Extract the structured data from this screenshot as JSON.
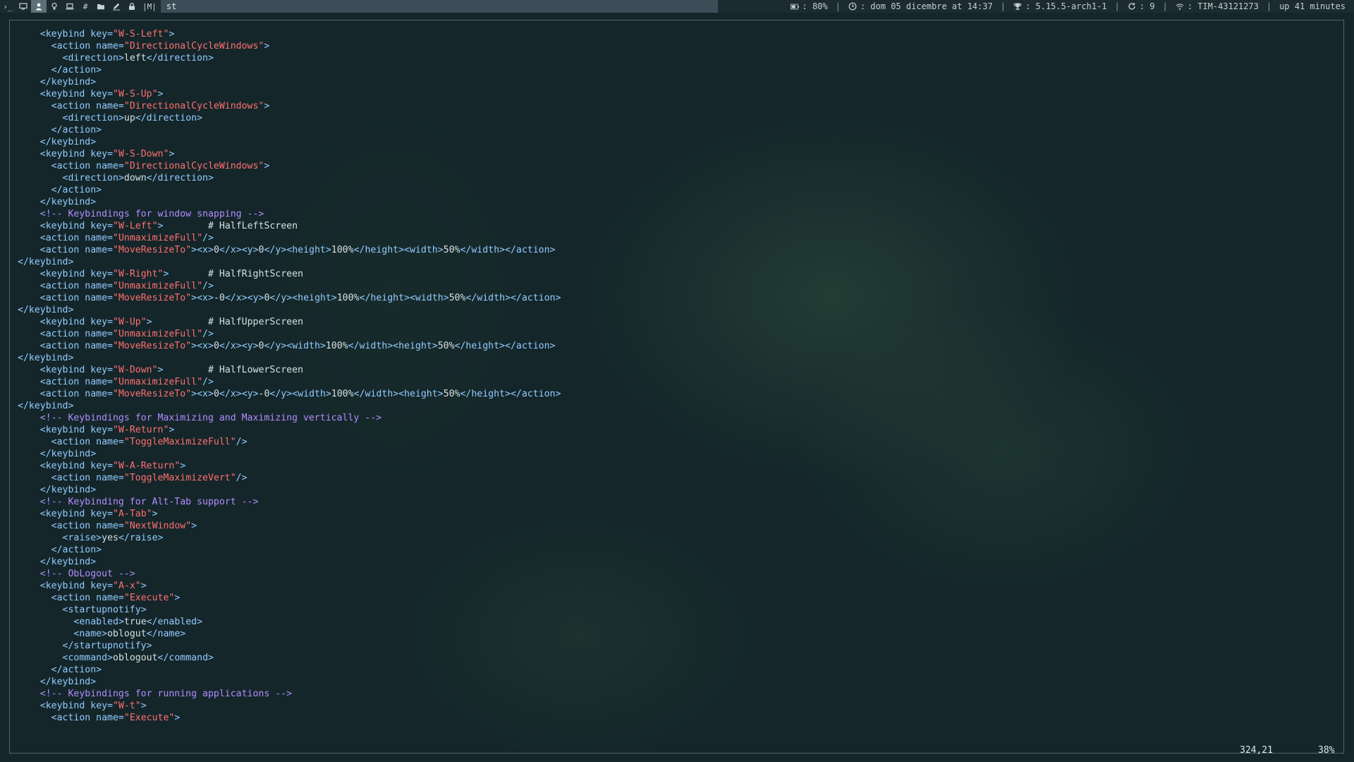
{
  "workspaces": [
    {
      "icon": "terminal-icon",
      "glyph": "›_"
    },
    {
      "icon": "monitor-icon",
      "glyph": ""
    },
    {
      "icon": "user-icon",
      "glyph": "",
      "active": true
    },
    {
      "icon": "lightbulb-icon",
      "glyph": ""
    },
    {
      "icon": "laptop-icon",
      "glyph": ""
    },
    {
      "icon": "hash-icon",
      "glyph": "#"
    },
    {
      "icon": "folder-icon",
      "glyph": ""
    },
    {
      "icon": "pencil-icon",
      "glyph": ""
    },
    {
      "icon": "lock-icon",
      "glyph": ""
    }
  ],
  "layout_symbol": "|M|",
  "window_title": "st",
  "status": {
    "battery": ": 80%",
    "clock": ": dom 05 dicembre at 14:37",
    "kernel": ": 5.15.5-arch1-1",
    "updates": ": 9",
    "wifi": ": TIM-43121273",
    "uptime": "up 41 minutes"
  },
  "colors": {
    "tag": "#93ccff",
    "string": "#ff6f6f",
    "comment": "#b48cff",
    "text": "#d7e0e1"
  },
  "editor": {
    "cursor_position": "324,21",
    "scroll_percent": "38%",
    "lines": [
      "    <keybind key=\"W-S-Left\">",
      "      <action name=\"DirectionalCycleWindows\">",
      "        <direction>left</direction>",
      "      </action>",
      "    </keybind>",
      "    <keybind key=\"W-S-Up\">",
      "      <action name=\"DirectionalCycleWindows\">",
      "        <direction>up</direction>",
      "      </action>",
      "    </keybind>",
      "    <keybind key=\"W-S-Down\">",
      "      <action name=\"DirectionalCycleWindows\">",
      "        <direction>down</direction>",
      "      </action>",
      "    </keybind>",
      "    <!-- Keybindings for window snapping -->",
      "    <keybind key=\"W-Left\">        # HalfLeftScreen",
      "    <action name=\"UnmaximizeFull\"/>",
      "    <action name=\"MoveResizeTo\"><x>0</x><y>0</y><height>100%</height><width>50%</width></action>",
      "</keybind>",
      "    <keybind key=\"W-Right\">       # HalfRightScreen",
      "    <action name=\"UnmaximizeFull\"/>",
      "    <action name=\"MoveResizeTo\"><x>-0</x><y>0</y><height>100%</height><width>50%</width></action>",
      "</keybind>",
      "    <keybind key=\"W-Up\">          # HalfUpperScreen",
      "    <action name=\"UnmaximizeFull\"/>",
      "    <action name=\"MoveResizeTo\"><x>0</x><y>0</y><width>100%</width><height>50%</height></action>",
      "</keybind>",
      "    <keybind key=\"W-Down\">        # HalfLowerScreen",
      "    <action name=\"UnmaximizeFull\"/>",
      "    <action name=\"MoveResizeTo\"><x>0</x><y>-0</y><width>100%</width><height>50%</height></action>",
      "</keybind>",
      "    <!-- Keybindings for Maximizing and Maximizing vertically -->",
      "    <keybind key=\"W-Return\">",
      "      <action name=\"ToggleMaximizeFull\"/>",
      "    </keybind>",
      "    <keybind key=\"W-A-Return\">",
      "      <action name=\"ToggleMaximizeVert\"/>",
      "    </keybind>",
      "    <!-- Keybinding for Alt-Tab support -->",
      "    <keybind key=\"A-Tab\">",
      "      <action name=\"NextWindow\">",
      "        <raise>yes</raise>",
      "      </action>",
      "    </keybind>",
      "    <!-- ObLogout -->",
      "    <keybind key=\"A-x\">",
      "      <action name=\"Execute\">",
      "        <startupnotify>",
      "          <enabled>true</enabled>",
      "          <name>oblogut</name>",
      "        </startupnotify>",
      "        <command>oblogout</command>",
      "      </action>",
      "    </keybind>",
      "    <!-- Keybindings for running applications -->",
      "    <keybind key=\"W-t\">",
      "      <action name=\"Execute\">"
    ]
  }
}
